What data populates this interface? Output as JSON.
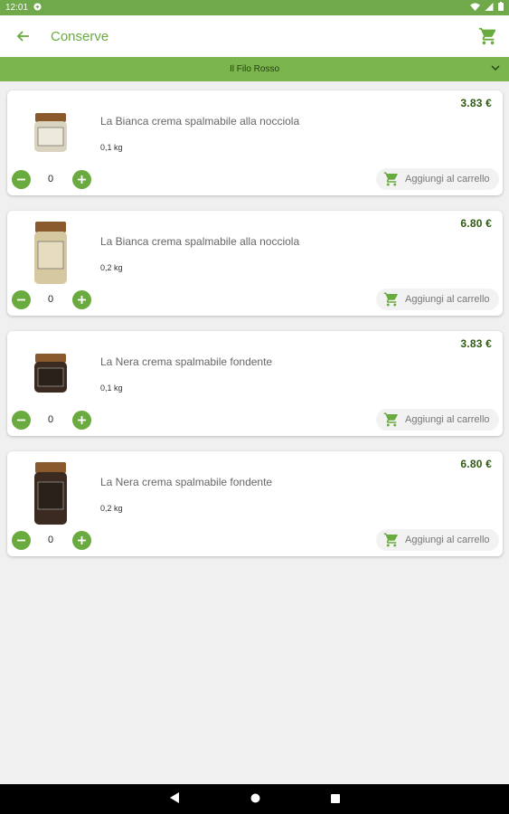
{
  "status_bar": {
    "time": "12:01"
  },
  "app_bar": {
    "title": "Conserve"
  },
  "filter": {
    "label": "Il Filo Rosso"
  },
  "products": [
    {
      "name": "La Bianca crema spalmabile alla nocciola",
      "weight": "0,1 kg",
      "price": "3.83 €",
      "quantity": "0",
      "add_label": "Aggiungi al carrello",
      "jar": "white-small"
    },
    {
      "name": "La Bianca crema spalmabile alla nocciola",
      "weight": "0,2 kg",
      "price": "6.80 €",
      "quantity": "0",
      "add_label": "Aggiungi al carrello",
      "jar": "white-large"
    },
    {
      "name": "La Nera crema spalmabile fondente",
      "weight": "0,1 kg",
      "price": "3.83 €",
      "quantity": "0",
      "add_label": "Aggiungi al carrello",
      "jar": "dark-small"
    },
    {
      "name": "La Nera crema spalmabile fondente",
      "weight": "0,2 kg",
      "price": "6.80 €",
      "quantity": "0",
      "add_label": "Aggiungi al carrello",
      "jar": "dark-large"
    }
  ],
  "colors": {
    "accent": "#6aab3f",
    "filter_bar": "#7bb54e",
    "status_bar": "#6fa94a",
    "price": "#2e5a12"
  }
}
